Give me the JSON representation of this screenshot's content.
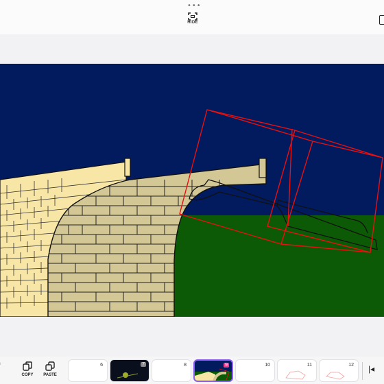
{
  "topbar": {
    "menu_icon": "more-dots-icon",
    "hide_label": "HIDE",
    "hide_icon": "hide-frame-icon"
  },
  "scene": {
    "colors": {
      "sky": "#021a5e",
      "grass": "#0c5a05",
      "wall": "#f8e6a6",
      "arch_stone": "#d4c796",
      "outline": "#111111",
      "selection": "#e81010"
    }
  },
  "toolbar": {
    "undo_label": "o",
    "copy_label": "COPY",
    "paste_label": "PASTE",
    "copy_icon": "copy-icon",
    "paste_icon": "paste-icon",
    "skip_icon": "skip-to-start-icon"
  },
  "frames": [
    {
      "number": "6"
    },
    {
      "number": "7"
    },
    {
      "number": "8"
    },
    {
      "number": "9"
    },
    {
      "number": "10"
    },
    {
      "number": "11"
    },
    {
      "number": "12"
    }
  ]
}
